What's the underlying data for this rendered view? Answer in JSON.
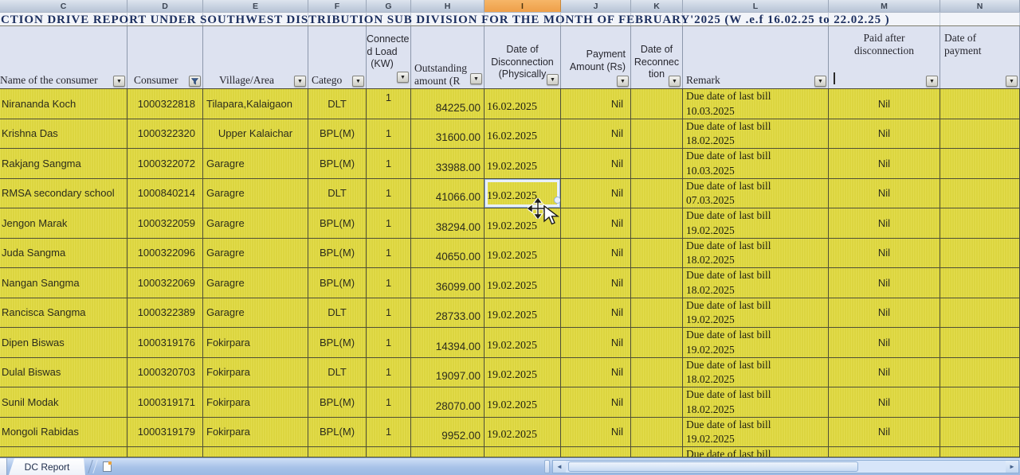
{
  "sheet": {
    "column_letters": [
      "C",
      "D",
      "E",
      "F",
      "G",
      "H",
      "I",
      "J",
      "K",
      "L",
      "M",
      "N"
    ],
    "highlighted_column": "I",
    "title": "CTION DRIVE REPORT UNDER SOUTHWEST DISTRIBUTION SUB DIVISION FOR THE MONTH OF FEBRUARY'2025 (W .e.f 16.02.25 to 22.02.25 )",
    "headers": {
      "name": "Name of the consumer",
      "consumer": "Consumer",
      "village": "Village/Area",
      "category": "Catego",
      "connected_load": "Connecte\nd Load\n(KW)",
      "outstanding": "Outstanding\namount (R",
      "disconnection": "Date of\nDisconnection\n(Physically",
      "payment": "Payment\nAmount (Rs)",
      "reconnection": "Date of\nReconnec\ntion",
      "remark": "Remark",
      "paid_after": "Paid after\ndisconnection",
      "date_of_payment": "Date of\npayment"
    },
    "rows": [
      {
        "name": "Nirananda Koch",
        "consumer_no": "1000322818",
        "village": "Tilapara,Kalaigaon",
        "category": "DLT",
        "connected_load": "1",
        "outstanding_amount": "84225.00",
        "disconnection_date": "16.02.2025",
        "payment_amount": "Nil",
        "reconnection_date": "",
        "remark": "Due date of last bill\n10.03.2025",
        "paid_after_disconnection": "Nil",
        "date_of_payment": ""
      },
      {
        "name": "Krishna Das",
        "consumer_no": "1000322320",
        "village": "Upper Kalaichar",
        "category": "BPL(M)",
        "connected_load": "1",
        "outstanding_amount": "31600.00",
        "disconnection_date": "16.02.2025",
        "payment_amount": "Nil",
        "reconnection_date": "",
        "remark": "Due date of last bill\n18.02.2025",
        "paid_after_disconnection": "Nil",
        "date_of_payment": ""
      },
      {
        "name": "Rakjang Sangma",
        "consumer_no": "1000322072",
        "village": "Garagre",
        "category": "BPL(M)",
        "connected_load": "1",
        "outstanding_amount": "33988.00",
        "disconnection_date": "19.02.2025",
        "payment_amount": "Nil",
        "reconnection_date": "",
        "remark": "Due date of last bill\n10.03.2025",
        "paid_after_disconnection": "Nil",
        "date_of_payment": ""
      },
      {
        "name": "RMSA secondary school",
        "consumer_no": "1000840214",
        "village": "Garagre",
        "category": "DLT",
        "connected_load": "1",
        "outstanding_amount": "41066.00",
        "disconnection_date": "19.02.2025",
        "payment_amount": "Nil",
        "reconnection_date": "",
        "remark": "Due date of last bill\n07.03.2025",
        "paid_after_disconnection": "Nil",
        "date_of_payment": ""
      },
      {
        "name": "Jengon Marak",
        "consumer_no": "1000322059",
        "village": "Garagre",
        "category": "BPL(M)",
        "connected_load": "1",
        "outstanding_amount": "38294.00",
        "disconnection_date": "19.02.2025",
        "payment_amount": "Nil",
        "reconnection_date": "",
        "remark": "Due date of last bill\n19.02.2025",
        "paid_after_disconnection": "Nil",
        "date_of_payment": ""
      },
      {
        "name": "Juda Sangma",
        "consumer_no": "1000322096",
        "village": "Garagre",
        "category": "BPL(M)",
        "connected_load": "1",
        "outstanding_amount": "40650.00",
        "disconnection_date": "19.02.2025",
        "payment_amount": "Nil",
        "reconnection_date": "",
        "remark": "Due date of last bill\n18.02.2025",
        "paid_after_disconnection": "Nil",
        "date_of_payment": ""
      },
      {
        "name": "Nangan Sangma",
        "consumer_no": "1000322069",
        "village": "Garagre",
        "category": "BPL(M)",
        "connected_load": "1",
        "outstanding_amount": "36099.00",
        "disconnection_date": "19.02.2025",
        "payment_amount": "Nil",
        "reconnection_date": "",
        "remark": "Due date of last bill\n18.02.2025",
        "paid_after_disconnection": "Nil",
        "date_of_payment": ""
      },
      {
        "name": "Rancisca Sangma",
        "consumer_no": "1000322389",
        "village": "Garagre",
        "category": "DLT",
        "connected_load": "1",
        "outstanding_amount": "28733.00",
        "disconnection_date": "19.02.2025",
        "payment_amount": "Nil",
        "reconnection_date": "",
        "remark": "Due date of last bill\n19.02.2025",
        "paid_after_disconnection": "Nil",
        "date_of_payment": ""
      },
      {
        "name": "Dipen Biswas",
        "consumer_no": "1000319176",
        "village": "Fokirpara",
        "category": "BPL(M)",
        "connected_load": "1",
        "outstanding_amount": "14394.00",
        "disconnection_date": "19.02.2025",
        "payment_amount": "Nil",
        "reconnection_date": "",
        "remark": "Due date of last bill\n19.02.2025",
        "paid_after_disconnection": "Nil",
        "date_of_payment": ""
      },
      {
        "name": "Dulal Biswas",
        "consumer_no": "1000320703",
        "village": "Fokirpara",
        "category": "DLT",
        "connected_load": "1",
        "outstanding_amount": "19097.00",
        "disconnection_date": "19.02.2025",
        "payment_amount": "Nil",
        "reconnection_date": "",
        "remark": "Due date of last bill\n18.02.2025",
        "paid_after_disconnection": "Nil",
        "date_of_payment": ""
      },
      {
        "name": "Sunil Modak",
        "consumer_no": "1000319171",
        "village": "Fokirpara",
        "category": "BPL(M)",
        "connected_load": "1",
        "outstanding_amount": "28070.00",
        "disconnection_date": "19.02.2025",
        "payment_amount": "Nil",
        "reconnection_date": "",
        "remark": "Due date of last bill\n18.02.2025",
        "paid_after_disconnection": "Nil",
        "date_of_payment": ""
      },
      {
        "name": "Mongoli Rabidas",
        "consumer_no": "1000319179",
        "village": "Fokirpara",
        "category": "BPL(M)",
        "connected_load": "1",
        "outstanding_amount": "9952.00",
        "disconnection_date": "19.02.2025",
        "payment_amount": "Nil",
        "reconnection_date": "",
        "remark": "Due date of last bill\n19.02.2025",
        "paid_after_disconnection": "Nil",
        "date_of_payment": ""
      }
    ],
    "partial_row": {
      "remark": "Due date of last bill"
    },
    "selection": {
      "row_index": 3,
      "column": "disconnection-date",
      "value": "19.02.2025"
    },
    "tab_bar": {
      "active_tab": "DC Report"
    }
  },
  "icons": {
    "dropdown_arrow": "▼",
    "filter_applied": "funnel-with-arrow",
    "scroll_left": "◄",
    "scroll_right": "►",
    "text_cursor": "|"
  },
  "colors": {
    "cell_fill_yellow": "#e0d940",
    "header_fill": "#dde2f0",
    "highlighted_column_fill": "#ee9f48",
    "title_text": "#1c2f5f",
    "tab_bar_fill": "#a7c2e8",
    "selection_border": "#e9f0fc"
  }
}
